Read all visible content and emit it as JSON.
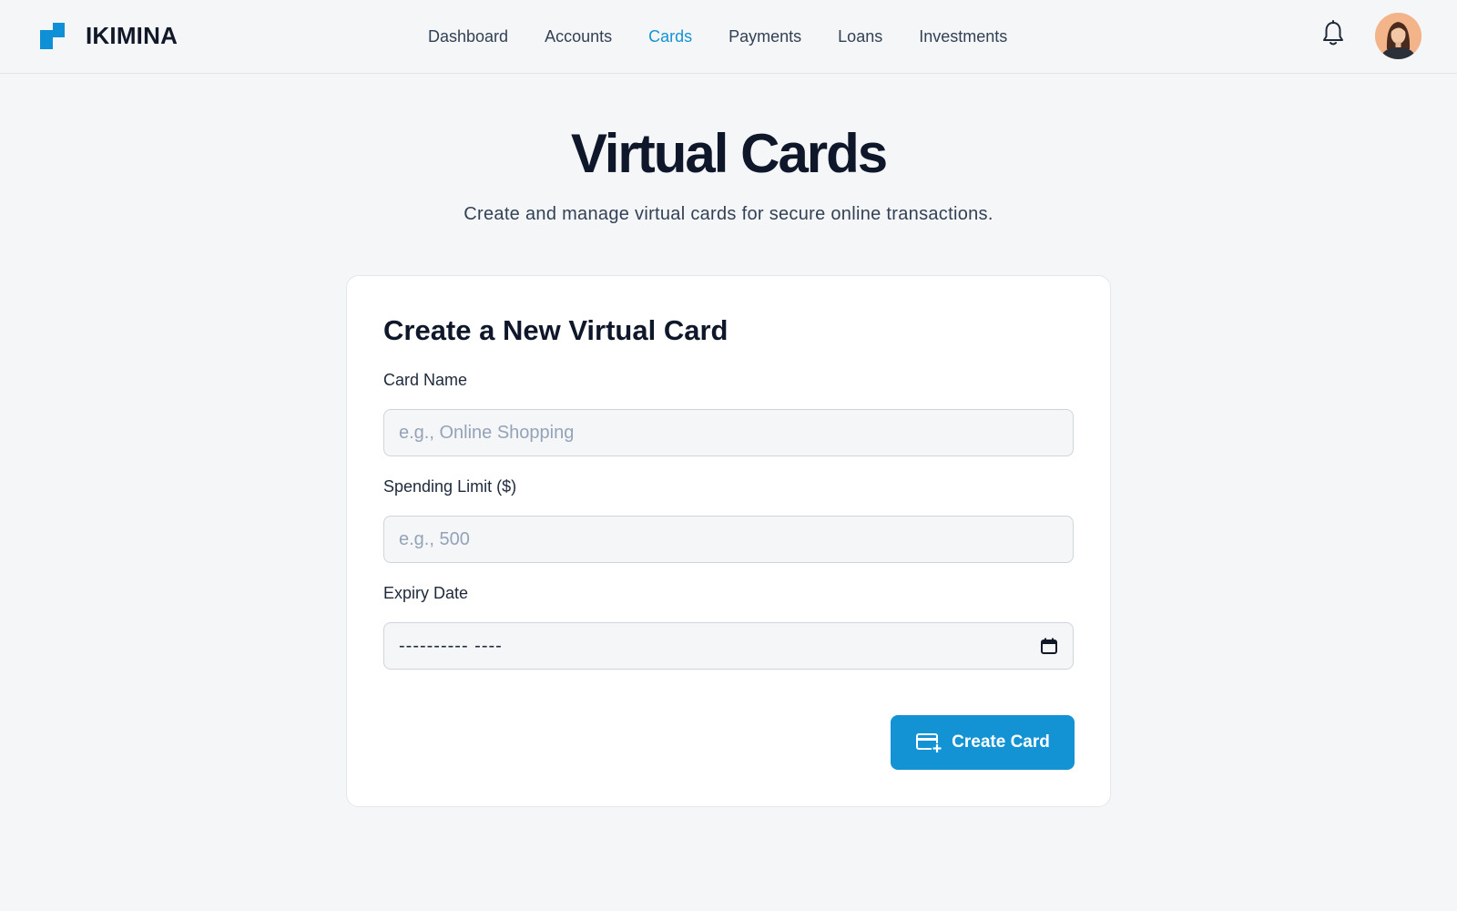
{
  "app": {
    "name": "IKIMINA"
  },
  "nav": {
    "items": [
      {
        "label": "Dashboard",
        "active": false
      },
      {
        "label": "Accounts",
        "active": false
      },
      {
        "label": "Cards",
        "active": true
      },
      {
        "label": "Payments",
        "active": false
      },
      {
        "label": "Loans",
        "active": false
      },
      {
        "label": "Investments",
        "active": false
      }
    ]
  },
  "header": {
    "icons": [
      "bell-icon",
      "avatar"
    ]
  },
  "page": {
    "title": "Virtual Cards",
    "subtitle": "Create and manage virtual cards for secure online transactions."
  },
  "form": {
    "title": "Create a New Virtual Card",
    "card_name": {
      "label": "Card Name",
      "placeholder": "e.g., Online Shopping",
      "value": ""
    },
    "spending_limit": {
      "label": "Spending Limit ($)",
      "placeholder": "e.g., 500",
      "value": ""
    },
    "expiry_date": {
      "label": "Expiry Date",
      "display": "---------- ----"
    },
    "submit_label": "Create Card"
  },
  "colors": {
    "accent": "#1493d4",
    "background": "#f5f6f8",
    "text": "#0f172a"
  }
}
